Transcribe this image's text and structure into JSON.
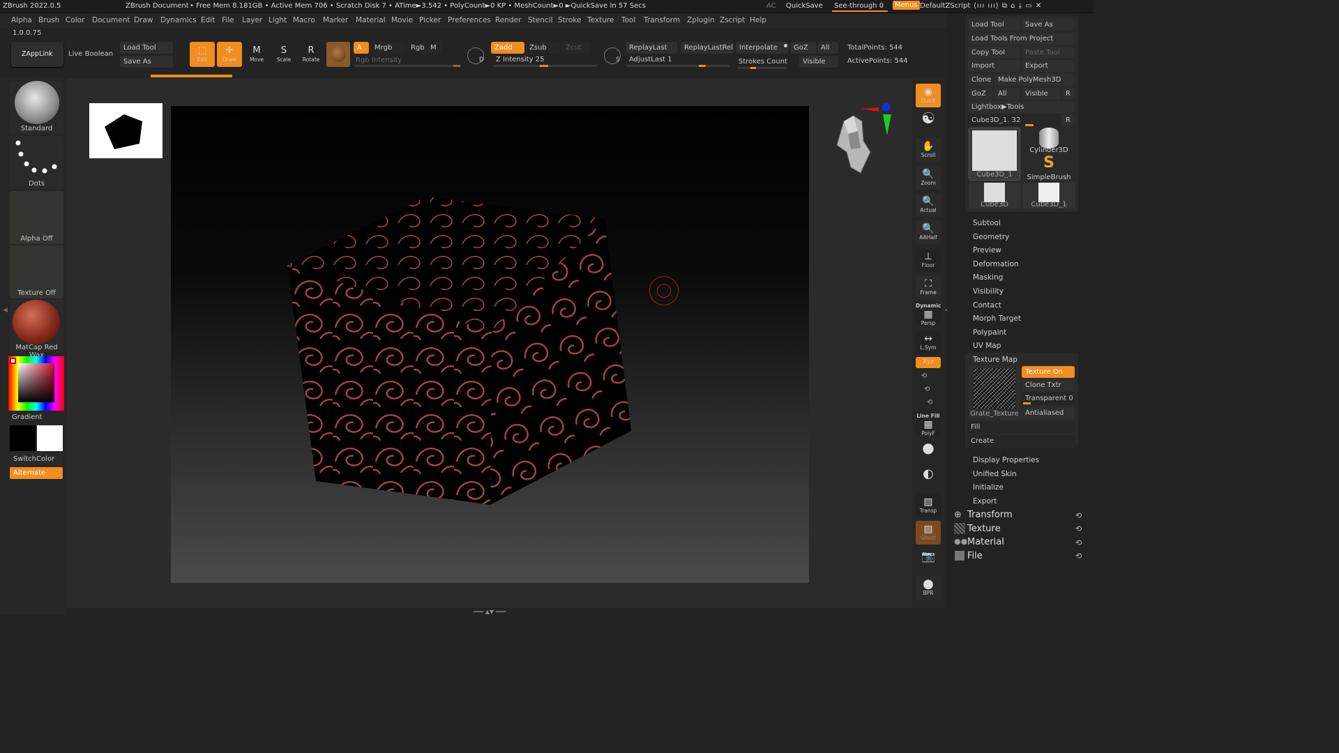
{
  "title_bar": {
    "app": "ZBrush 2022.0.5",
    "document": "ZBrush Document",
    "stats": "• Free Mem 8.181GB • Active Mem 706 • Scratch Disk 7 •  ATime►3.542 • PolyCount►0 KP  • MeshCount►0  ►QuickSave In 57 Secs",
    "ac": "AC",
    "quicksave": "QuickSave",
    "see_through": "See-through  0",
    "menus": "Menus",
    "default_zscript": "DefaultZScript"
  },
  "menu": [
    "Alpha",
    "Brush",
    "Color",
    "Document",
    "Draw",
    "Dynamics",
    "Edit",
    "File",
    "Layer",
    "Light",
    "Macro",
    "Marker",
    "Material",
    "Movie",
    "Picker",
    "Preferences",
    "Render",
    "Stencil",
    "Stroke",
    "Texture",
    "Tool",
    "Transform",
    "Zplugin",
    "Zscript",
    "Help"
  ],
  "version": "1.0.0.75",
  "top_shelf": {
    "zapplink": "ZAppLink",
    "live_boolean": "Live Boolean",
    "load_tool": "Load Tool",
    "save_as": "Save As",
    "edit": "Edit",
    "draw": "Draw",
    "move": "Move",
    "scale": "Scale",
    "rotate": "Rotate",
    "a": "A",
    "mrgb": "Mrgb",
    "rgb": "Rgb",
    "m": "M",
    "rgb_intensity": "Rgb Intensity",
    "zadd": "Zadd",
    "zsub": "Zsub",
    "zcut": "Zcut",
    "z_intensity": "Z Intensity 25",
    "replay_last": "ReplayLast",
    "replay_last_rel": "ReplayLastRel",
    "adjust_last": "AdjustLast 1",
    "interpolate": "Interpolate",
    "strokes_count": "Strokes Count",
    "goz": "GoZ",
    "all": "All",
    "visible": "Visible",
    "total_points": "TotalPoints: 544",
    "active_points": "ActivePoints: 544"
  },
  "left_panel": {
    "standard": "Standard",
    "dots": "Dots",
    "alpha_off": "Alpha Off",
    "texture_off": "Texture Off",
    "matcap": "MatCap Red Wax",
    "gradient": "Gradient",
    "switch_color": "SwitchColor",
    "alternate": "Alternate"
  },
  "right_shelf": [
    "Quick",
    "",
    "Scroll",
    "Zoom",
    "Actual",
    "AAHalf",
    "Floor",
    "Frame",
    "Persp",
    "L.Sym",
    "Xyz",
    "",
    "",
    "",
    "PolyF",
    "",
    "",
    "Transp",
    "Ghost",
    "",
    "BPR"
  ],
  "right_shelf_extra": {
    "dynamic": "Dynamic",
    "line_fill": "Line Fill"
  },
  "tool_panel": {
    "load_tool": "Load Tool",
    "save_as": "Save As",
    "load_from_project": "Load Tools From Project",
    "copy_tool": "Copy Tool",
    "paste_tool": "Paste Tool",
    "import": "Import",
    "export": "Export",
    "clone": "Clone",
    "make_polymesh": "Make PolyMesh3D",
    "goz": "GoZ",
    "all": "All",
    "visible": "Visible",
    "r": "R",
    "lightbox_tools": "Lightbox▶Tools",
    "current_tool": "Cube3D_1. 32",
    "thumbs": [
      "Cube3D_1",
      "Cylinder3D",
      "SimpleBrush",
      "Cube3D",
      "Cube3D_1"
    ],
    "subpalettes": [
      "Subtool",
      "Geometry",
      "Preview",
      "Deformation",
      "Masking",
      "Visibility",
      "Contact",
      "Morph Target",
      "Polypaint",
      "UV Map",
      "Texture Map"
    ],
    "texture_on": "Texture On",
    "clone_txtr": "Clone Txtr",
    "transparent": "Transparent 0",
    "antialiased": "Antialiased",
    "grate_texture": "Grate_Texture",
    "fill": "Fill",
    "create": "Create",
    "subpalettes2": [
      "Display Properties",
      "Unified Skin",
      "Initialize",
      "Export"
    ],
    "palettes": [
      "Transform",
      "Texture",
      "Material",
      "File"
    ]
  },
  "colors": {
    "accent": "#f28d1f",
    "canvas_top": "#000000",
    "canvas_bottom": "#4a4a4a",
    "pattern": "#a8463a"
  }
}
